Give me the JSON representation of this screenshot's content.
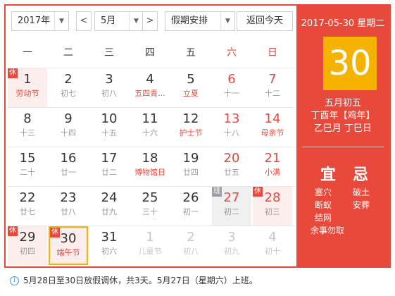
{
  "toolbar": {
    "year_value": "2017年",
    "prev_month": "<",
    "month_value": "5月",
    "next_month": ">",
    "holiday_value": "假期安排",
    "today_button": "返回今天",
    "dropdown_arrow": "▼"
  },
  "weekdays": [
    "一",
    "二",
    "三",
    "四",
    "五",
    "六",
    "日"
  ],
  "weeks": [
    [
      {
        "day": "1",
        "sub": "劳动节",
        "fest": true,
        "tag": "休",
        "rest": true
      },
      {
        "day": "2",
        "sub": "初七"
      },
      {
        "day": "3",
        "sub": "初八"
      },
      {
        "day": "4",
        "sub": "五四青...",
        "fest": true
      },
      {
        "day": "5",
        "sub": "立夏",
        "fest": true
      },
      {
        "day": "6",
        "sub": "十一",
        "we": true
      },
      {
        "day": "7",
        "sub": "十二",
        "we": true
      }
    ],
    [
      {
        "day": "8",
        "sub": "十三"
      },
      {
        "day": "9",
        "sub": "十四"
      },
      {
        "day": "10",
        "sub": "十五"
      },
      {
        "day": "11",
        "sub": "十六"
      },
      {
        "day": "12",
        "sub": "护士节",
        "fest": true
      },
      {
        "day": "13",
        "sub": "十八",
        "we": true
      },
      {
        "day": "14",
        "sub": "母亲节",
        "we": true,
        "fest": true
      }
    ],
    [
      {
        "day": "15",
        "sub": "二十"
      },
      {
        "day": "16",
        "sub": "廿一"
      },
      {
        "day": "17",
        "sub": "廿二"
      },
      {
        "day": "18",
        "sub": "博物馆日",
        "fest": true
      },
      {
        "day": "19",
        "sub": "廿四"
      },
      {
        "day": "20",
        "sub": "廿五",
        "we": true
      },
      {
        "day": "21",
        "sub": "小满",
        "we": true,
        "fest": true
      }
    ],
    [
      {
        "day": "22",
        "sub": "廿七"
      },
      {
        "day": "23",
        "sub": "廿八"
      },
      {
        "day": "24",
        "sub": "廿九"
      },
      {
        "day": "25",
        "sub": "三十"
      },
      {
        "day": "26",
        "sub": "初一"
      },
      {
        "day": "27",
        "sub": "初二",
        "we": true,
        "tag": "班",
        "work": true
      },
      {
        "day": "28",
        "sub": "初三",
        "we": true,
        "tag": "休",
        "rest": true
      }
    ],
    [
      {
        "day": "29",
        "sub": "初四",
        "tag": "休",
        "rest": true
      },
      {
        "day": "30",
        "sub": "端午节",
        "fest": true,
        "tag": "休",
        "rest": true,
        "sel": true
      },
      {
        "day": "31",
        "sub": "初六"
      },
      {
        "day": "1",
        "sub": "儿童节",
        "other": true
      },
      {
        "day": "2",
        "sub": "初八",
        "other": true
      },
      {
        "day": "3",
        "sub": "初九",
        "other": true
      },
      {
        "day": "4",
        "sub": "初十",
        "other": true
      }
    ]
  ],
  "panel": {
    "date_line": "2017-05-30 星期二",
    "big_day": "30",
    "lunar_md": "五月初五",
    "lunar_year": "丁酉年【鸡年】",
    "ganzhi": "乙巳月 丁巳日",
    "yi_title": "宜",
    "ji_title": "忌",
    "yi_items": [
      "塞穴",
      "断蚁",
      "结网",
      "余事勿取"
    ],
    "ji_items": [
      "破土",
      "安葬"
    ]
  },
  "info": {
    "icon": "i",
    "text": "5月28日至30日放假调休，共3天。5月27日（星期六）上班。"
  },
  "colors": {
    "accent": "#e8493b",
    "highlight": "#f5b300"
  }
}
